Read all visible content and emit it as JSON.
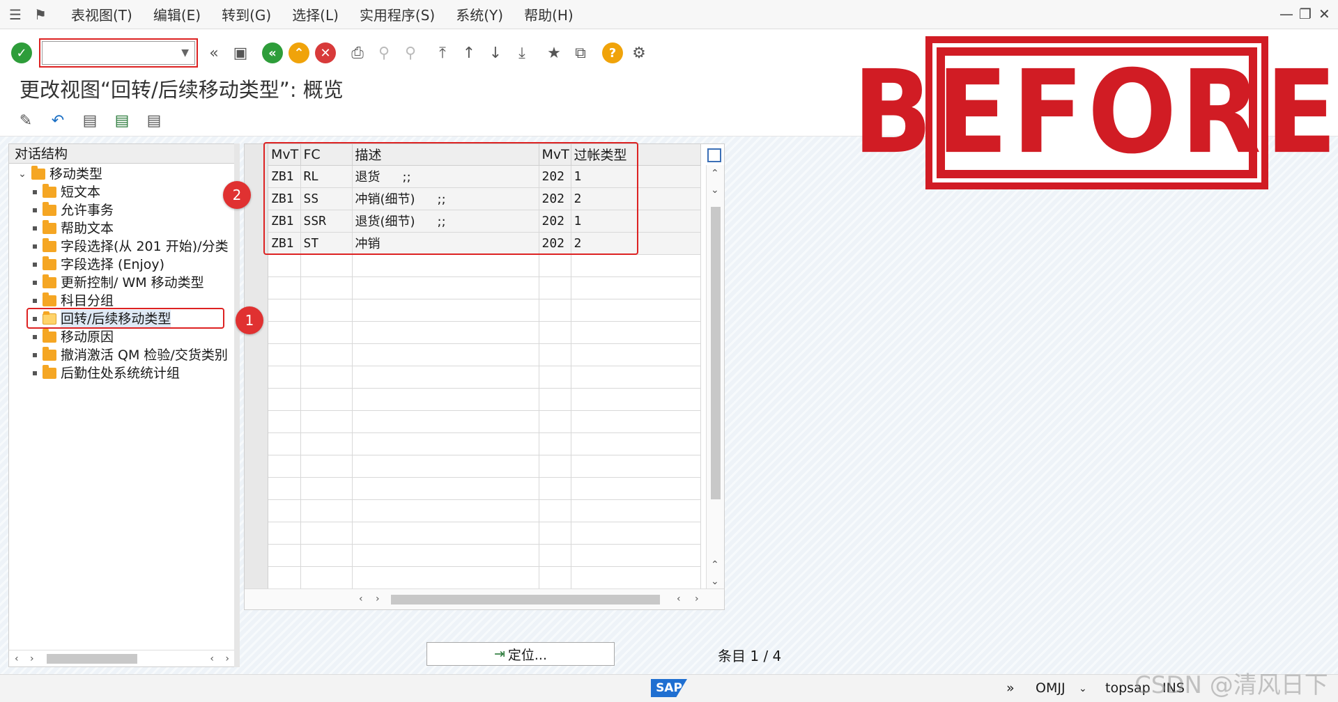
{
  "menubar": {
    "items": [
      "表视图(T)",
      "编辑(E)",
      "转到(G)",
      "选择(L)",
      "实用程序(S)",
      "系统(Y)",
      "帮助(H)"
    ]
  },
  "window_controls": [
    "minimize-icon",
    "restore-icon",
    "close-icon"
  ],
  "toolbar": {
    "command_field_value": "",
    "icons": [
      "check-icon",
      "double-left-icon",
      "save-icon",
      "back-icon",
      "exit-icon",
      "cancel-icon",
      "print-icon",
      "find-icon",
      "find-next-icon",
      "first-page-icon",
      "previous-page-icon",
      "next-page-icon",
      "last-page-icon",
      "bookmark-icon",
      "create-session-icon",
      "help-icon",
      "settings-icon"
    ]
  },
  "page_title": "更改视图“回转/后续移动类型”: 概览",
  "stamp_text": "BEFORE",
  "tree": {
    "header": "对话结构",
    "root": "移动类型",
    "items": [
      "短文本",
      "允许事务",
      "帮助文本",
      "字段选择(从 201 开始)/分类",
      "字段选择 (Enjoy)",
      "更新控制/ WM 移动类型",
      "科目分组",
      "回转/后续移动类型",
      "移动原因",
      "撤消激活 QM 检验/交货类别",
      "后勤住处系统统计组"
    ],
    "selected_index": 7
  },
  "annotations": {
    "badge_1": "1",
    "badge_2": "2"
  },
  "table": {
    "columns": [
      "MvT",
      "FC",
      "描述",
      "MvT",
      "过帐类型"
    ],
    "rows": [
      {
        "mvt": "ZB1",
        "fc": "RL",
        "desc": "退货",
        "suffix": ";;",
        "mvt2": "202",
        "post": "1"
      },
      {
        "mvt": "ZB1",
        "fc": "SS",
        "desc": "冲销(细节)",
        "suffix": ";;",
        "mvt2": "202",
        "post": "2"
      },
      {
        "mvt": "ZB1",
        "fc": "SSR",
        "desc": "退货(细节)",
        "suffix": ";;",
        "mvt2": "202",
        "post": "1"
      },
      {
        "mvt": "ZB1",
        "fc": "ST",
        "desc": "冲销",
        "suffix": "",
        "mvt2": "202",
        "post": "2"
      }
    ],
    "empty_rows": 15
  },
  "position_button": "定位...",
  "entry_label": "条目 1 / 4",
  "statusbar": {
    "logo": "SAP",
    "transaction": "OMJJ",
    "server": "topsap",
    "mode": "INS",
    "watermark": "CSDN @清风日下"
  }
}
